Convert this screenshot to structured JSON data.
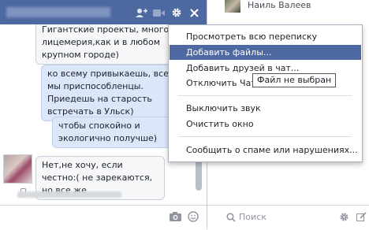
{
  "chat": {
    "messages": [
      "Гигантские проекты, много лицемерия,как и в любом крупном городе)",
      "ко всему привыкаешь, все мы приспособленцы. Приедешь на старость встречать в Ульск)",
      "чтобы спокойно и экологично получше)",
      "Нет,не хочу, если честно:( не зарекаются, но все же"
    ],
    "composer_placeholder": ""
  },
  "header_icons": [
    "add-friend-icon",
    "video-call-icon",
    "gear-icon",
    "close-icon"
  ],
  "menu": {
    "items": [
      "Просмотреть всю переписку",
      "Добавить файлы...",
      "Добавить друзей в чат...",
      "Отключить Чат",
      "Выключить звук",
      "Очистить окно",
      "Сообщить о спаме или нарушениях..."
    ],
    "active_index": 1
  },
  "tooltip": "Файл не выбран",
  "contact": {
    "name": "Наиль Валеев"
  },
  "search": {
    "placeholder": "Поиск"
  },
  "colors": {
    "header": "#4e69a2",
    "menu_highlight": "#4e69a2",
    "outgoing_bubble": "#dbe6f8"
  }
}
